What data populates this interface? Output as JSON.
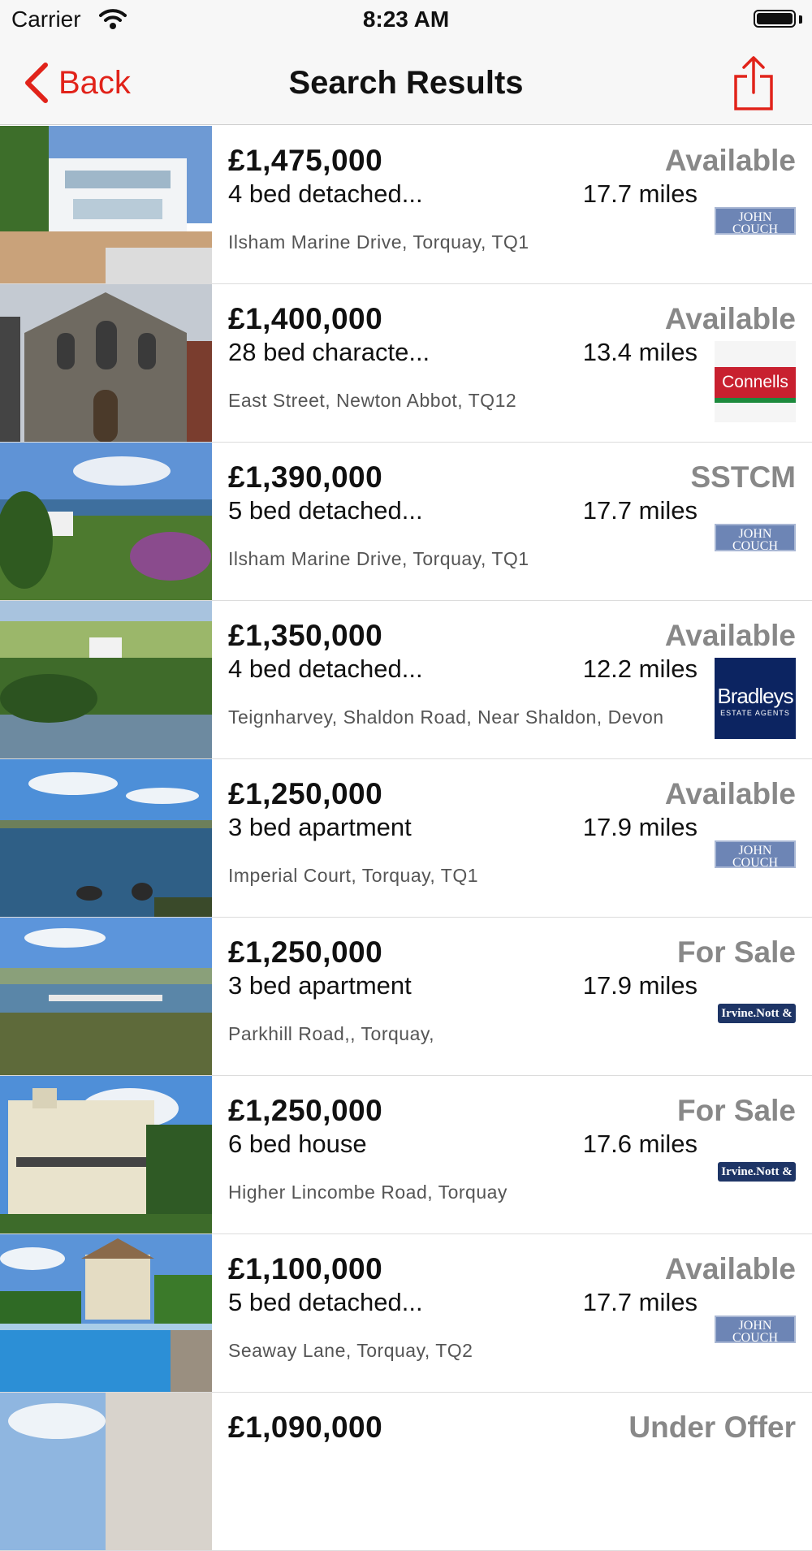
{
  "status_bar": {
    "carrier": "Carrier",
    "time": "8:23 AM"
  },
  "nav": {
    "back_label": "Back",
    "title": "Search Results",
    "accent_color": "#e1231a"
  },
  "listings": [
    {
      "price": "£1,475,000",
      "description": "4 bed detached...",
      "address": "Ilsham Marine Drive, Torquay, TQ1",
      "status": "Available",
      "distance": "17.7 miles",
      "agent": "JOHN COUCH",
      "agent_tagline": "THE ESTATE AGENT"
    },
    {
      "price": "£1,400,000",
      "description": "28 bed characte...",
      "address": "East Street, Newton Abbot, TQ12",
      "status": "Available",
      "distance": "13.4 miles",
      "agent": "Connells"
    },
    {
      "price": "£1,390,000",
      "description": "5 bed detached...",
      "address": "Ilsham Marine Drive, Torquay, TQ1",
      "status": "SSTCM",
      "distance": "17.7 miles",
      "agent": "JOHN COUCH",
      "agent_tagline": "THE ESTATE AGENT"
    },
    {
      "price": "£1,350,000",
      "description": "4 bed detached...",
      "address": "Teignharvey, Shaldon Road, Near Shaldon, Devon",
      "status": "Available",
      "distance": "12.2 miles",
      "agent": "Bradleys",
      "agent_tagline": "ESTATE AGENTS"
    },
    {
      "price": "£1,250,000",
      "description": "3 bed apartment",
      "address": "Imperial Court, Torquay, TQ1",
      "status": "Available",
      "distance": "17.9 miles",
      "agent": "JOHN COUCH",
      "agent_tagline": "THE ESTATE AGENT"
    },
    {
      "price": "£1,250,000",
      "description": "3 bed apartment",
      "address": "Parkhill Road,, Torquay,",
      "status": "For Sale",
      "distance": "17.9 miles",
      "agent": "Irvine.Nott & Co"
    },
    {
      "price": "£1,250,000",
      "description": "6 bed house",
      "address": "Higher Lincombe Road, Torquay",
      "status": "For Sale",
      "distance": "17.6 miles",
      "agent": "Irvine.Nott & Co"
    },
    {
      "price": "£1,100,000",
      "description": "5 bed detached...",
      "address": "Seaway Lane, Torquay, TQ2",
      "status": "Available",
      "distance": "17.7 miles",
      "agent": "JOHN COUCH",
      "agent_tagline": "THE ESTATE AGENT"
    },
    {
      "price": "£1,090,000",
      "status": "Under Offer"
    }
  ]
}
